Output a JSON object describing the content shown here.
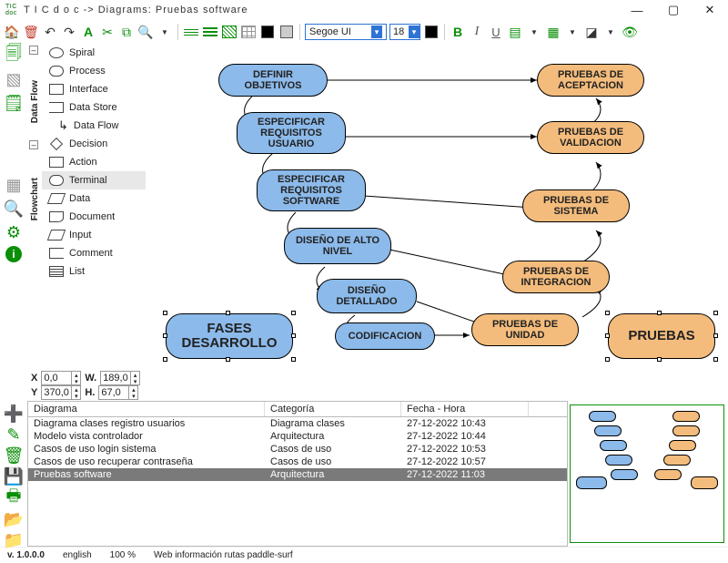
{
  "title": "T I C d o c -> Diagrams: Pruebas software",
  "tic_label": "TIC\ndoc",
  "toolbar": {
    "font": "Segoe UI",
    "font_size": "18",
    "color_a": "#000000",
    "color_b": "#cccccc"
  },
  "palette": {
    "group_dataflow": "Data Flow",
    "group_flowchart": "Flowchart",
    "items": [
      {
        "label": "Spiral"
      },
      {
        "label": "Process"
      },
      {
        "label": "Interface"
      },
      {
        "label": "Data Store"
      },
      {
        "label": "Data Flow"
      },
      {
        "label": "Decision"
      },
      {
        "label": "Action"
      },
      {
        "label": "Terminal"
      },
      {
        "label": "Data"
      },
      {
        "label": "Document"
      },
      {
        "label": "Input"
      },
      {
        "label": "Comment"
      },
      {
        "label": "List"
      }
    ]
  },
  "coords": {
    "X": "0,0",
    "Y": "370,0",
    "W": "189,0",
    "H": "67,0",
    "xl": "X",
    "yl": "Y",
    "wl": "W.",
    "hl": "H."
  },
  "nodes": {
    "n1": "DEFINIR OBJETIVOS",
    "n2": "ESPECIFICAR REQUISITOS USUARIO",
    "n3": "ESPECIFICAR REQUISITOS SOFTWARE",
    "n4": "DISEÑO DE ALTO NIVEL",
    "n5": "DISEÑO DETALLADO",
    "n6": "CODIFICACION",
    "n7": "FASES DESARROLLO",
    "r1": "PRUEBAS DE ACEPTACION",
    "r2": "PRUEBAS DE VALIDACION",
    "r3": "PRUEBAS DE SISTEMA",
    "r4": "PRUEBAS DE INTEGRACION",
    "r5": "PRUEBAS DE UNIDAD",
    "r6": "PRUEBAS"
  },
  "table": {
    "h1": "Diagrama",
    "h2": "Categoría",
    "h3": "Fecha - Hora",
    "rows": [
      {
        "a": "Diagrama clases registro usuarios",
        "b": "Diagrama clases",
        "c": "27-12-2022 10:43"
      },
      {
        "a": "Modelo vista controlador",
        "b": "Arquitectura",
        "c": "27-12-2022 10:44"
      },
      {
        "a": "Casos de uso login sistema",
        "b": "Casos de uso",
        "c": "27-12-2022 10:53"
      },
      {
        "a": "Casos de uso recuperar contraseña",
        "b": "Casos de uso",
        "c": "27-12-2022 10:57"
      },
      {
        "a": "Pruebas software",
        "b": "Arquitectura",
        "c": "27-12-2022 11:03"
      }
    ]
  },
  "status": {
    "version": "v. 1.0.0.0",
    "lang": "english",
    "zoom": "100 %",
    "proj": "Web información rutas paddle-surf"
  }
}
